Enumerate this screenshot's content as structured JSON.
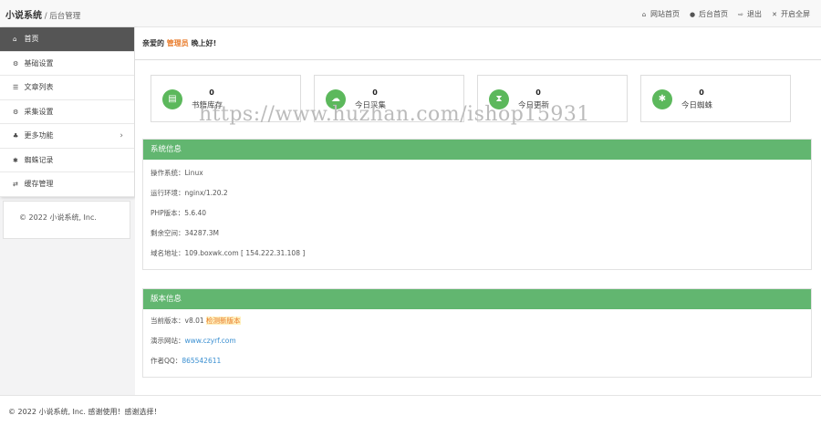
{
  "header": {
    "brand": "小说系统",
    "subtitle": " / 后台管理",
    "nav": [
      {
        "icon": "home-icon",
        "label": "网站首页"
      },
      {
        "icon": "user-icon",
        "label": "后台首页"
      },
      {
        "icon": "logout-icon",
        "label": "退出"
      },
      {
        "icon": "fullscreen-icon",
        "label": "开启全屏"
      }
    ]
  },
  "sidebar": {
    "items": [
      {
        "icon": "home-icon",
        "label": "首页"
      },
      {
        "icon": "gear-icon",
        "label": "基础设置"
      },
      {
        "icon": "list-icon",
        "label": "文章列表"
      },
      {
        "icon": "cogs-icon",
        "label": "采集设置"
      },
      {
        "icon": "sitemap-icon",
        "label": "更多功能"
      },
      {
        "icon": "bug-icon",
        "label": "蜘蛛记录"
      },
      {
        "icon": "refresh-icon",
        "label": "缓存管理"
      }
    ],
    "copyright": "© 2022 小说系统, Inc."
  },
  "welcome": {
    "prefix": "亲爱的 ",
    "role": "管理员",
    "suffix": " 晚上好!"
  },
  "stats": [
    {
      "icon": "book-icon",
      "value": "0",
      "label": "书籍库存"
    },
    {
      "icon": "cloud-download-icon",
      "value": "0",
      "label": "今日采集"
    },
    {
      "icon": "hourglass-icon",
      "value": "0",
      "label": "今日更新"
    },
    {
      "icon": "bug-icon",
      "value": "0",
      "label": "今日蜘蛛"
    }
  ],
  "watermark": "https://www.huzhan.com/ishop15931",
  "system_info": {
    "title": "系统信息",
    "os_label": "操作系统：",
    "os": "Linux",
    "env_label": "运行环境：",
    "env": "nginx/1.20.2",
    "php_label": "PHP版本：",
    "php": "5.6.40",
    "space_label": "剩余空间：",
    "space": "34287.3M",
    "domain_label": "域名地址：",
    "domain": "109.boxwk.com [ 154.222.31.108 ]"
  },
  "version_info": {
    "title": "版本信息",
    "current_label": "当前版本：",
    "current": "v8.01",
    "check_label": "检测新版本",
    "demo_label": "演示网站：",
    "demo": "www.czyrf.com",
    "qq_label": "作者QQ：",
    "qq": "865542611"
  },
  "footer": "© 2022 小说系统, Inc. 感谢使用！感谢选择！",
  "colors": {
    "accent_green": "#62b670",
    "role_orange": "#e87b2a",
    "link_blue": "#3a8fd1"
  }
}
